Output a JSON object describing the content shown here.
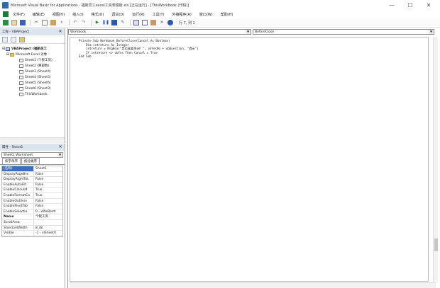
{
  "window": {
    "title": "Microsoft Visual Basic for Applications - 福新员工excel工资表模板.xls [正在运行] - [ThisWorkbook (代码)]",
    "minimize_glyph": "—",
    "maximize_glyph": "☐",
    "close_glyph": "✕"
  },
  "menu": {
    "items": [
      "文件(F)",
      "编辑(E)",
      "视图(V)",
      "插入(I)",
      "格式(O)",
      "调试(D)",
      "运行(R)",
      "工具(T)",
      "外接程序(A)",
      "窗口(W)",
      "帮助(H)"
    ]
  },
  "toolbar": {
    "cursor_position": "行 7, 列 1"
  },
  "project_pane": {
    "title": "工程 - VBAProject",
    "close_glyph": "✕",
    "tree": [
      {
        "label": "VBAProject (福新员工",
        "level": 0,
        "expander": "⊟",
        "kind": "proj"
      },
      {
        "label": "Microsoft Excel 对象",
        "level": 1,
        "expander": "⊟",
        "kind": "folder"
      },
      {
        "label": "Sheet1 (个税工资)",
        "level": 2,
        "expander": "",
        "kind": "sheet"
      },
      {
        "label": "Sheet2 (算部数)",
        "level": 2,
        "expander": "",
        "kind": "sheet"
      },
      {
        "label": "Sheet3 (Sheet4)",
        "level": 2,
        "expander": "",
        "kind": "sheet"
      },
      {
        "label": "Sheet4 (Sheet5)",
        "level": 2,
        "expander": "",
        "kind": "sheet"
      },
      {
        "label": "Sheet5 (Sheet6)",
        "level": 2,
        "expander": "",
        "kind": "sheet"
      },
      {
        "label": "Sheet6 (Sheet3)",
        "level": 2,
        "expander": "",
        "kind": "sheet"
      },
      {
        "label": "ThisWorkbook",
        "level": 2,
        "expander": "",
        "kind": "sheet"
      }
    ]
  },
  "props_pane": {
    "title": "属性 - Sheet1",
    "close_glyph": "✕",
    "object_select": "Sheet1 Worksheet",
    "tabs": [
      "按字母序",
      "按分类序"
    ],
    "rows": [
      {
        "name": "(名称)",
        "value": "Sheet1"
      },
      {
        "name": "DisplayPageBre",
        "value": "False"
      },
      {
        "name": "DisplayRightToL",
        "value": "False"
      },
      {
        "name": "EnableAutoFilt",
        "value": "False"
      },
      {
        "name": "EnableCalculat",
        "value": "True"
      },
      {
        "name": "EnableFormatCo",
        "value": "True"
      },
      {
        "name": "EnableOutlinin",
        "value": "False"
      },
      {
        "name": "EnablePivotTab",
        "value": "False"
      },
      {
        "name": "EnableSelectio",
        "value": "0 - xlNoRestr"
      },
      {
        "name": "Name",
        "value": "个税工资"
      },
      {
        "name": "ScrollArea",
        "value": ""
      },
      {
        "name": "StandardWidth",
        "value": "8.38"
      },
      {
        "name": "Visible",
        "value": "-1 - xlSheetV"
      }
    ]
  },
  "code_window": {
    "object_combo": "Workbook",
    "procedure_combo": "BeforeClose",
    "dropdown_glyph": "▼",
    "lines": [
      "Private Sub Workbook_BeforeClose(Cancel As Boolean)",
      "    Dim intreturn As Integer",
      "    intreturn = MsgBox(\"是否真要关闭？\", vbYesNo + vbQuestion, \"提示\")",
      "    If intreturn <> vbYes Then Cancel = True",
      "End Sub"
    ]
  },
  "colors": {
    "accent": "#3b6fc2",
    "pane_title_bg": "#dbe4ef"
  }
}
